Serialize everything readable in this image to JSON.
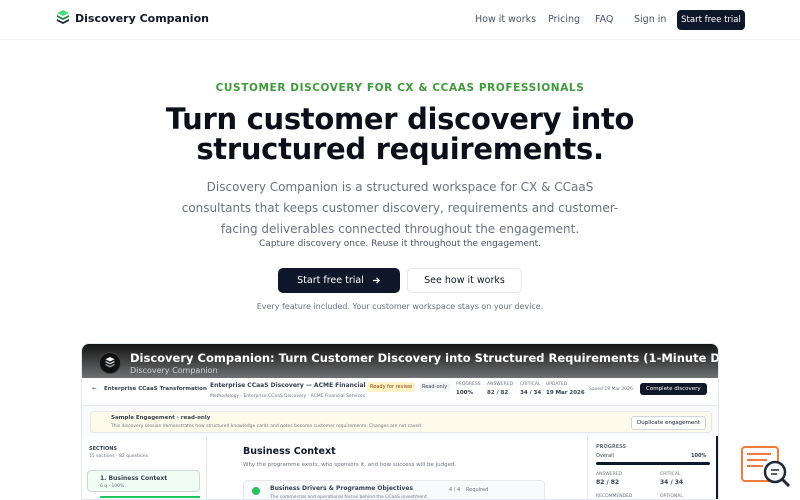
{
  "header": {
    "brand": "Discovery Companion",
    "nav": [
      "How it works",
      "Pricing",
      "FAQ",
      "Sign in"
    ],
    "cta": "Start free trial"
  },
  "hero": {
    "eyebrow": "CUSTOMER DISCOVERY FOR CX & CCAAS PROFESSIONALS",
    "headline": "Turn customer discovery into structured requirements.",
    "subheadline": "Discovery Companion is a structured workspace for CX & CCaaS consultants that keeps customer discovery, requirements and customer-facing deliverables connected throughout the engagement.",
    "tagline": "Capture discovery once. Reuse it throughout the engagement.",
    "primary_button": "Start free trial",
    "secondary_button": "See how it works",
    "note": "Every feature included. Your customer workspace stays on your device."
  },
  "video": {
    "title": "Discovery Companion: Turn Customer Discovery into Structured Requirements (1-Minute Demo)",
    "channel": "Discovery Companion",
    "app": {
      "back_label": "Enterprise CCaaS Transformation",
      "doc_title": "Enterprise CCaaS Discovery — ACME Financial Servi...",
      "breadcrumb": "Methodology · Enterprise CCaaS Discovery · ACME Financial Services",
      "status_ready": "Ready for review",
      "status_readonly": "Read-only",
      "stats": [
        {
          "label": "PROGRESS",
          "value": "100%"
        },
        {
          "label": "ANSWERED",
          "value": "82 / 82"
        },
        {
          "label": "CRITICAL",
          "value": "34 / 34"
        },
        {
          "label": "UPDATED",
          "value": "19 Mar 2026"
        }
      ],
      "saved": "Saved 19 Mar 2026",
      "complete_btn": "Complete discovery",
      "banner_title": "Sample Engagement · read-only",
      "banner_text": "This discovery session demonstrates how structured knowledge cards and notes become customer requirements. Changes are not saved.",
      "duplicate_btn": "Duplicate engagement",
      "sections_label": "SECTIONS",
      "sections_count": "15 sections · 82 questions",
      "section_item": "1. Business Context",
      "section_meta": "6 q · 100%",
      "main_title": "Business Context",
      "main_sub": "Why the programme exists, who sponsors it, and how success will be judged.",
      "card_title": "Business Drivers & Programme Objectives",
      "card_count": "4 / 4",
      "card_tag": "Required",
      "card_sub": "The commercial and operational forces behind the CCaaS investment.",
      "progress_label": "PROGRESS",
      "overall_label": "Overall",
      "overall_value": "100%",
      "answered_label": "ANSWERED",
      "answered_value": "82 / 82",
      "critical_label": "CRITICAL",
      "critical_value": "34 / 34",
      "recommended_label": "RECOMMENDED",
      "optional_label": "OPTIONAL"
    }
  },
  "colors": {
    "accent_green": "#3f9a3b",
    "dark": "#0f172a",
    "muted_text": "#6b7280",
    "widget_orange": "#f07c3b"
  }
}
